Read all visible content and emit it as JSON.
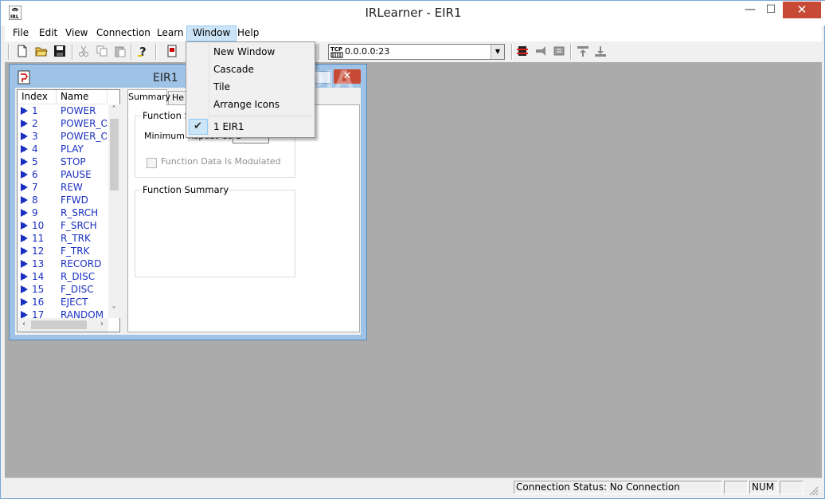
{
  "window": {
    "title": "IRLearner - EIR1",
    "app_icon_label": "IRL",
    "minimize_glyph": "—",
    "maximize_glyph": "☐",
    "close_glyph": "✕"
  },
  "menubar": {
    "items": [
      "File",
      "Edit",
      "View",
      "Connection",
      "Learn",
      "Window",
      "Help"
    ]
  },
  "window_menu": {
    "items": [
      "New Window",
      "Cascade",
      "Tile",
      "Arrange Icons"
    ],
    "window_list": [
      "1 EIR1"
    ],
    "checked_glyph": "✔"
  },
  "toolbar": {
    "host_icon_label": "TCP",
    "host_value": "0.0.0.0:23"
  },
  "child_window": {
    "title": "EIR1",
    "close_glyph": "✕",
    "list": {
      "columns": [
        "Index",
        "Name"
      ],
      "rows": [
        {
          "index": "1",
          "name": "POWER"
        },
        {
          "index": "2",
          "name": "POWER_ON"
        },
        {
          "index": "3",
          "name": "POWER_OFF"
        },
        {
          "index": "4",
          "name": "PLAY"
        },
        {
          "index": "5",
          "name": "STOP"
        },
        {
          "index": "6",
          "name": "PAUSE"
        },
        {
          "index": "7",
          "name": "REW"
        },
        {
          "index": "8",
          "name": "FFWD"
        },
        {
          "index": "9",
          "name": "R_SRCH"
        },
        {
          "index": "10",
          "name": "F_SRCH"
        },
        {
          "index": "11",
          "name": "R_TRK"
        },
        {
          "index": "12",
          "name": "F_TRK"
        },
        {
          "index": "13",
          "name": "RECORD"
        },
        {
          "index": "14",
          "name": "R_DISC"
        },
        {
          "index": "15",
          "name": "F_DISC"
        },
        {
          "index": "16",
          "name": "EJECT"
        },
        {
          "index": "17",
          "name": "RANDOM"
        }
      ]
    },
    "tabs": [
      "Summary",
      "He"
    ],
    "function_settings": {
      "group_label": "Function Se",
      "repeat_label": "Minimum Repeat Count",
      "repeat_value": "1",
      "modulated_label": "Function Data Is Modulated"
    },
    "function_summary": {
      "group_label": "Function Summary"
    }
  },
  "statusbar": {
    "connection": "Connection Status: No Connection",
    "num": "NUM"
  },
  "watermark": "SOFTPEDIA"
}
